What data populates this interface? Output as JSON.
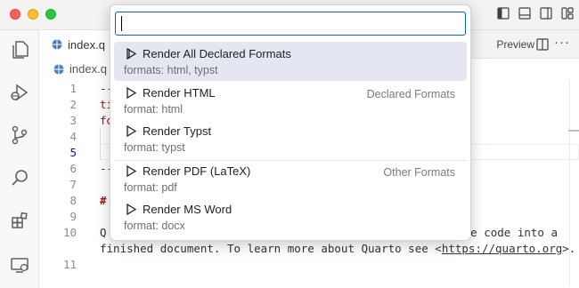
{
  "window": {
    "tab_label": "index.q",
    "breadcrumb": "index.q",
    "preview_label": "Preview",
    "more_label": "···"
  },
  "editor": {
    "lines": [
      {
        "num": "1",
        "text": "--"
      },
      {
        "num": "2",
        "text": "ti"
      },
      {
        "num": "3",
        "text": "fo"
      },
      {
        "num": "4",
        "text": ""
      },
      {
        "num": "5",
        "text": ""
      },
      {
        "num": "6",
        "text": "--"
      },
      {
        "num": "7",
        "text": ""
      },
      {
        "num": "8",
        "text": "#"
      },
      {
        "num": "9",
        "text": ""
      },
      {
        "num": "10",
        "text_a": "Q",
        "text_a_right": "e code into a",
        "text_b_pre": "finished document. To learn more about Quarto see <",
        "text_b_link": "https://quarto.org",
        "text_b_post": ">."
      },
      {
        "num": "11",
        "text": ""
      }
    ]
  },
  "quick_pick": {
    "input_value": "",
    "items": [
      {
        "label": "Render All Declared Formats",
        "description": "formats: html, typst",
        "group": "",
        "selected": true
      },
      {
        "label": "Render HTML",
        "description": "format: html",
        "group": "Declared Formats",
        "selected": false
      },
      {
        "label": "Render Typst",
        "description": "format: typst",
        "group": "",
        "selected": false
      },
      {
        "label": "Render PDF (LaTeX)",
        "description": "format: pdf",
        "group": "Other Formats",
        "selected": false
      },
      {
        "label": "Render MS Word",
        "description": "format: docx",
        "group": "",
        "selected": false
      }
    ]
  },
  "colors": {
    "selection": "#e4e6f1",
    "input_border": "#0a61cf",
    "keyword_red": "#a31515"
  },
  "icons": [
    "files-icon",
    "run-debug-icon",
    "source-control-icon",
    "search-icon",
    "extensions-icon",
    "remote-explorer-icon",
    "quarto-file-icon",
    "play-icon",
    "split-editor-icon"
  ]
}
